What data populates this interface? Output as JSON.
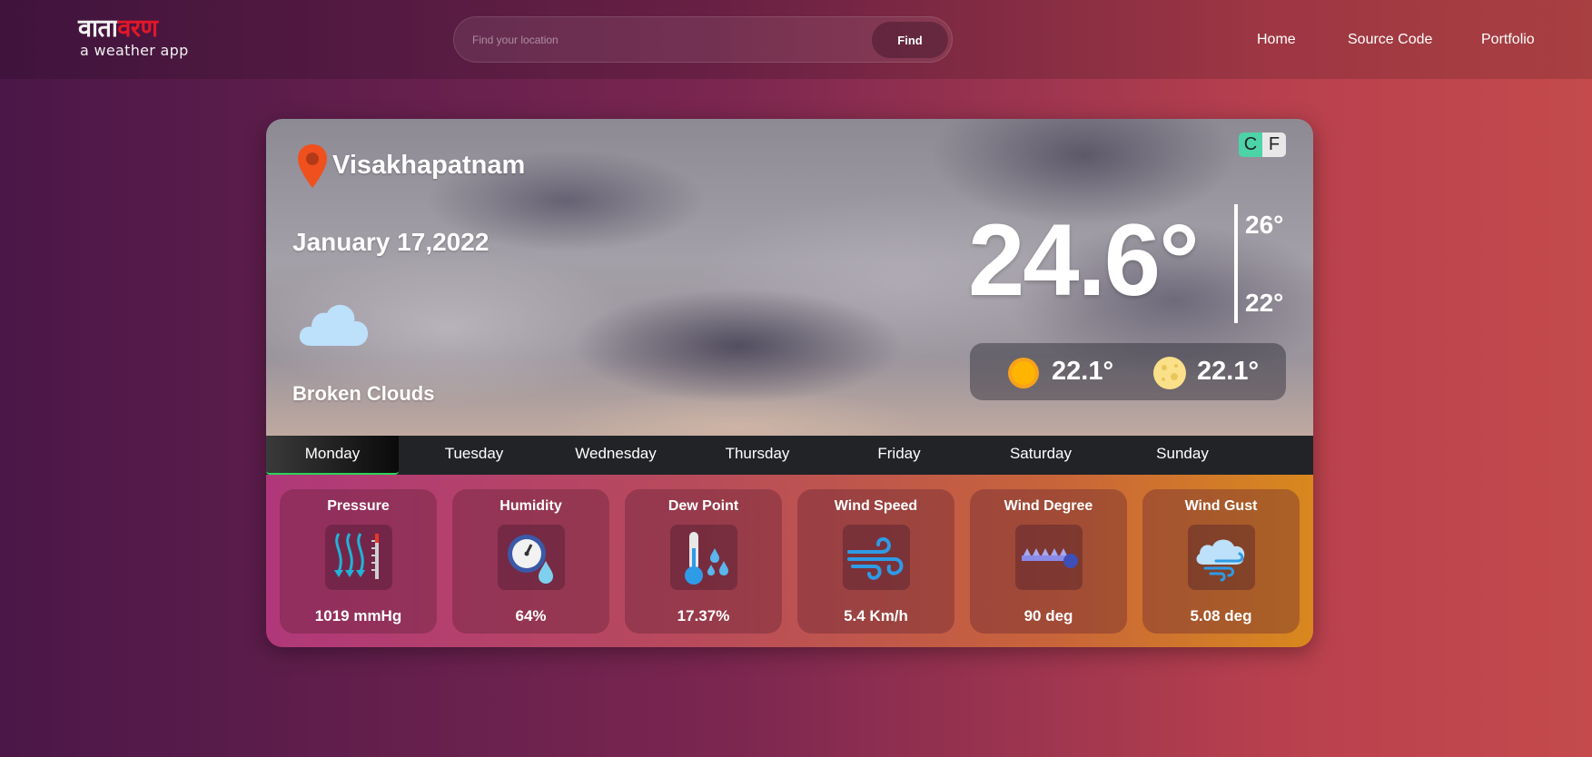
{
  "header": {
    "logo_part1": "वाता",
    "logo_part2": "वरण",
    "logo_tagline": "a weather app",
    "search_placeholder": "Find your location",
    "search_value": "",
    "find_label": "Find",
    "nav": {
      "home": "Home",
      "source": "Source Code",
      "portfolio": "Portfolio"
    }
  },
  "weather": {
    "city": "Visakhapatnam",
    "date": "January 17,2022",
    "condition": "Broken Clouds",
    "unit_c": "C",
    "unit_f": "F",
    "temp": "24.6°",
    "temp_max": "26°",
    "temp_min": "22°",
    "sun_temp": "22.1°",
    "moon_temp": "22.1°"
  },
  "tabs": [
    "Monday",
    "Tuesday",
    "Wednesday",
    "Thursday",
    "Friday",
    "Saturday",
    "Sunday"
  ],
  "metrics": [
    {
      "title": "Pressure",
      "value": "1019 mmHg",
      "icon": "pressure-icon"
    },
    {
      "title": "Humidity",
      "value": "64%",
      "icon": "humidity-icon"
    },
    {
      "title": "Dew Point",
      "value": "17.37%",
      "icon": "dew-point-icon"
    },
    {
      "title": "Wind Speed",
      "value": "5.4 Km/h",
      "icon": "wind-speed-icon"
    },
    {
      "title": "Wind Degree",
      "value": "90 deg",
      "icon": "wind-degree-icon"
    },
    {
      "title": "Wind Gust",
      "value": "5.08 deg",
      "icon": "wind-gust-icon"
    }
  ],
  "colors": {
    "unit_active": "#4dd3a8",
    "tab_indicator": "#2bd35a",
    "logo_accent": "#e3162a"
  }
}
